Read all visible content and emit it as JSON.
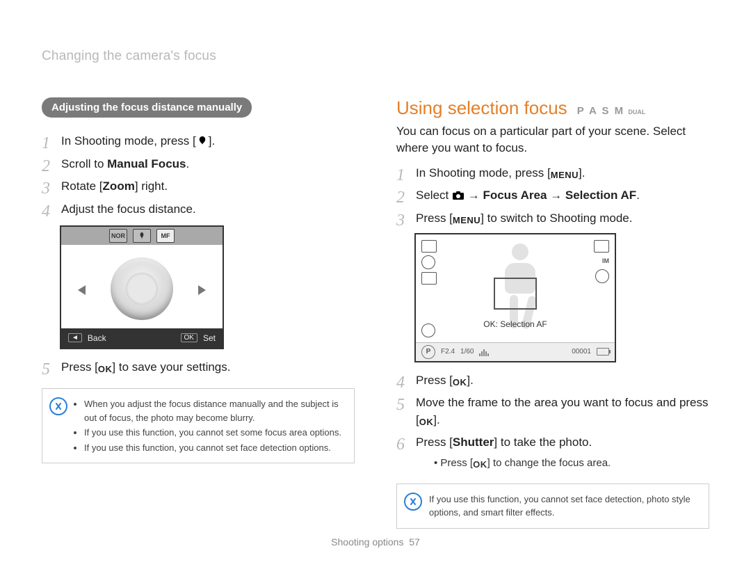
{
  "breadcrumb": "Changing the camera's focus",
  "left": {
    "pill": "Adjusting the focus distance manually",
    "steps": {
      "s1_pre": "In Shooting mode, press [",
      "s1_post": "].",
      "s2_pre": "Scroll to ",
      "s2_bold": "Manual Focus",
      "s2_post": ".",
      "s3_pre": "Rotate [",
      "s3_bold": "Zoom",
      "s3_post": "] right.",
      "s4": "Adjust the focus distance.",
      "s5_pre": "Press [",
      "s5_ok": "OK",
      "s5_post": "] to save your settings."
    },
    "lcd": {
      "top_tile_1": "NOR",
      "top_tile_3": "MF",
      "back_chip": "◄",
      "back_label": "Back",
      "set_chip": "OK",
      "set_label": "Set"
    },
    "notes": [
      "When you adjust the focus distance manually and the subject is out of focus, the photo may become blurry.",
      "If you use this function, you cannot set some focus area options.",
      "If you use this function, you cannot set face detection options."
    ]
  },
  "right": {
    "heading": "Using selection focus",
    "modes": "P A S M",
    "mode_extra": "DUAL",
    "intro": "You can focus on a particular part of your scene. Select where you want to focus.",
    "steps": {
      "s1_pre": "In Shooting mode, press [",
      "s1_menu": "MENU",
      "s1_post": "].",
      "s2_pre": "Select ",
      "s2_arrow": " → ",
      "s2_b1": "Focus Area",
      "s2_b2": "Selection AF",
      "s2_post": ".",
      "s3_pre": "Press [",
      "s3_menu": "MENU",
      "s3_post": "] to switch to Shooting mode.",
      "s4_pre": "Press [",
      "s4_ok": "OK",
      "s4_post": "].",
      "s5_pre": "Move the frame to the area you want to focus and press [",
      "s5_ok": "OK",
      "s5_post": "].",
      "s6_pre": "Press [",
      "s6_bold": "Shutter",
      "s6_post": "] to take the photo.",
      "s6_sub_pre": "Press [",
      "s6_sub_ok": "OK",
      "s6_sub_post": "] to change the focus area."
    },
    "lcd": {
      "label": "OK: Selection AF",
      "hud_im": "IM",
      "mode_letter": "P",
      "fnum": "F2.4",
      "shutter": "1/60",
      "counter": "00001"
    },
    "note": "If you use this function, you cannot set face detection, photo style options, and smart filter effects."
  },
  "footer": {
    "section": "Shooting options",
    "page": "57"
  }
}
